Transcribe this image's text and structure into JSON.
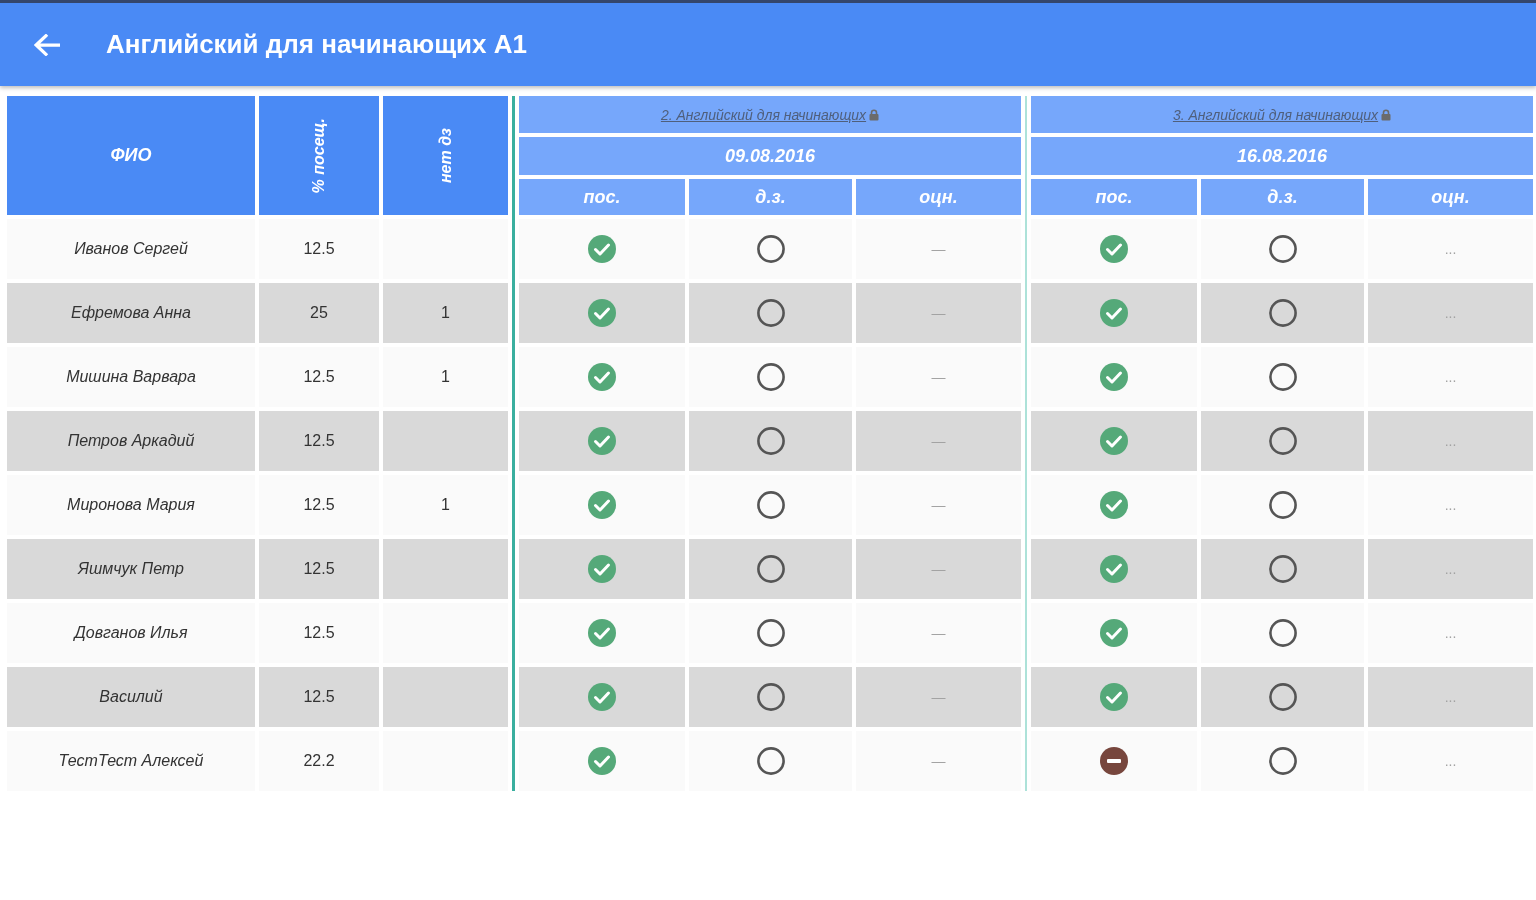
{
  "app_bar": {
    "title": "Английский для начинающих А1"
  },
  "table": {
    "columns": [
      {
        "label": "ФИО",
        "kind": "horizontal"
      },
      {
        "label": "% посещ.",
        "kind": "vertical"
      },
      {
        "label": "нет дз",
        "kind": "vertical"
      }
    ],
    "lessons": [
      {
        "title": "2. Английский для начинающих",
        "locked": true,
        "date": "09.08.2016",
        "subcolumns": [
          "пос.",
          "д.з.",
          "оцн."
        ]
      },
      {
        "title": "3. Английский для начинающих",
        "locked": true,
        "date": "16.08.2016",
        "subcolumns": [
          "пос.",
          "д.з.",
          "оцн."
        ]
      }
    ],
    "rows": [
      {
        "name": "Иванов Сергей",
        "attendance_percent": "12.5",
        "lessons": [
          {
            "present": true,
            "homework_done": false,
            "grade": "—"
          },
          {
            "present": true,
            "homework_done": false,
            "grade": "..."
          }
        ]
      },
      {
        "name": "Ефремова Анна",
        "attendance_percent": "25",
        "no_homework": "1",
        "lessons": [
          {
            "present": true,
            "homework_done": false,
            "grade": "—"
          },
          {
            "present": true,
            "homework_done": false,
            "grade": "..."
          }
        ]
      },
      {
        "name": "Мишина Варвара",
        "attendance_percent": "12.5",
        "no_homework": "1",
        "lessons": [
          {
            "present": true,
            "homework_done": false,
            "grade": "—"
          },
          {
            "present": true,
            "homework_done": false,
            "grade": "..."
          }
        ]
      },
      {
        "name": "Петров Аркадий",
        "attendance_percent": "12.5",
        "lessons": [
          {
            "present": true,
            "homework_done": false,
            "grade": "—"
          },
          {
            "present": true,
            "homework_done": false,
            "grade": "..."
          }
        ]
      },
      {
        "name": "Миронова Мария",
        "attendance_percent": "12.5",
        "no_homework": "1",
        "lessons": [
          {
            "present": true,
            "homework_done": false,
            "grade": "—"
          },
          {
            "present": true,
            "homework_done": false,
            "grade": "..."
          }
        ]
      },
      {
        "name": "Яшмчук Петр",
        "attendance_percent": "12.5",
        "lessons": [
          {
            "present": true,
            "homework_done": false,
            "grade": "—"
          },
          {
            "present": true,
            "homework_done": false,
            "grade": "..."
          }
        ]
      },
      {
        "name": "Довганов Илья",
        "attendance_percent": "12.5",
        "lessons": [
          {
            "present": true,
            "homework_done": false,
            "grade": "—"
          },
          {
            "present": true,
            "homework_done": false,
            "grade": "..."
          }
        ]
      },
      {
        "name": "Василий",
        "attendance_percent": "12.5",
        "lessons": [
          {
            "present": true,
            "homework_done": false,
            "grade": "—"
          },
          {
            "present": true,
            "homework_done": false,
            "grade": "..."
          }
        ]
      },
      {
        "name": "ТестТест Алексей",
        "attendance_percent": "22.2",
        "lessons": [
          {
            "present": true,
            "homework_done": false,
            "grade": "—"
          },
          {
            "present": false,
            "homework_done": false,
            "grade": "..."
          }
        ]
      }
    ]
  }
}
